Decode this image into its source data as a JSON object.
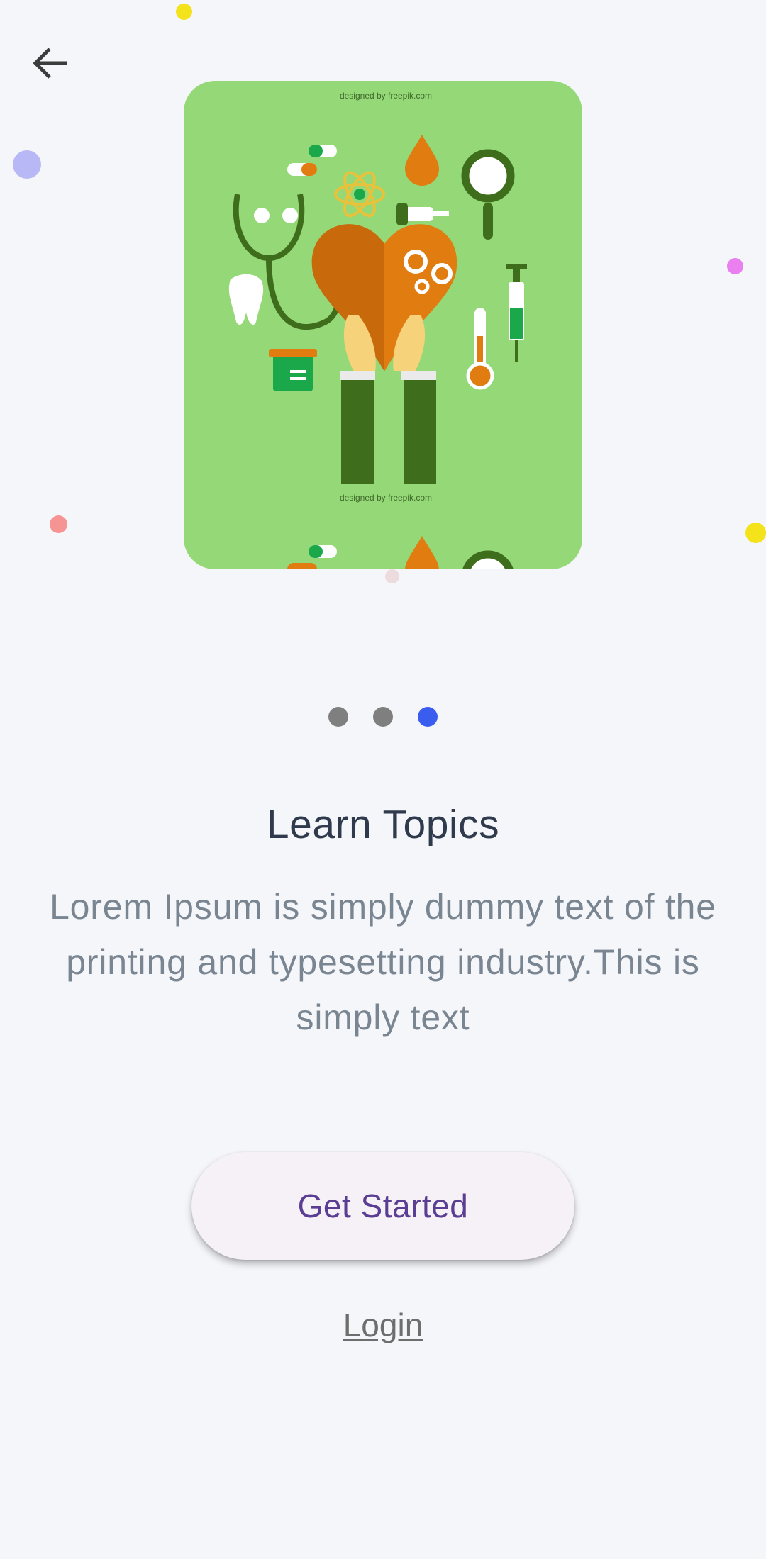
{
  "header": {
    "back_icon": "arrow-left-icon"
  },
  "decor": {
    "colors": {
      "yellow": "#f4e21b",
      "lavender": "#b9b8f6",
      "magenta": "#ea7ff0",
      "salmon": "#f59492",
      "blush": "#ecdcde"
    }
  },
  "hero": {
    "illustration": "medical-health-icons-illustration",
    "background_color": "#95d877",
    "credit_top": "designed by freepik.com",
    "credit_bottom": "designed by freepik.com"
  },
  "pager": {
    "count": 3,
    "active_index": 2,
    "active_color": "#3a5df0",
    "inactive_color": "#7f7f7f"
  },
  "content": {
    "title": "Learn Topics",
    "description": "Lorem Ipsum is simply dummy text of the printing and typesetting industry.This is simply text"
  },
  "actions": {
    "primary_label": "Get Started",
    "secondary_label": "Login"
  }
}
